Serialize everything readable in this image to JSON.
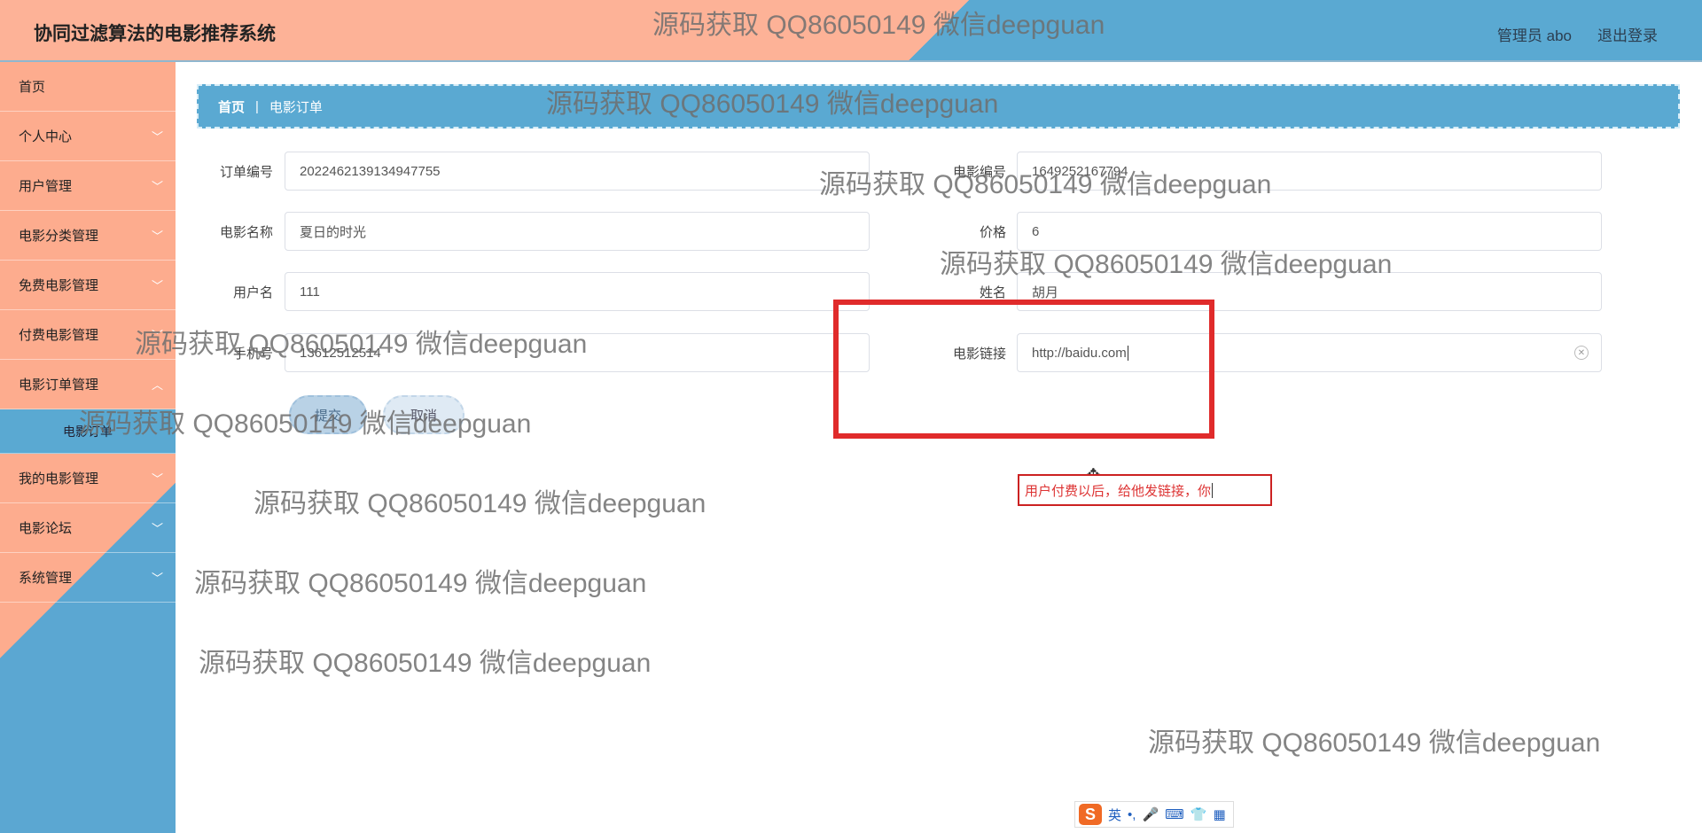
{
  "header": {
    "title": "协同过滤算法的电影推荐系统",
    "admin": "管理员 abo",
    "logout": "退出登录"
  },
  "sidebar": {
    "items": [
      {
        "label": "首页"
      },
      {
        "label": "个人中心"
      },
      {
        "label": "用户管理"
      },
      {
        "label": "电影分类管理"
      },
      {
        "label": "免费电影管理"
      },
      {
        "label": "付费电影管理"
      },
      {
        "label": "电影订单管理"
      },
      {
        "label": "我的电影管理"
      },
      {
        "label": "电影论坛"
      },
      {
        "label": "系统管理"
      }
    ],
    "submenu": "电影订单"
  },
  "breadcrumb": {
    "home": "首页",
    "separator": "|",
    "current": "电影订单"
  },
  "form": {
    "order_no_label": "订单编号",
    "order_no_value": "2022462139134947755",
    "movie_no_label": "电影编号",
    "movie_no_value": "1649252167794",
    "movie_name_label": "电影名称",
    "movie_name_value": "夏日的时光",
    "price_label": "价格",
    "price_value": "6",
    "username_label": "用户名",
    "username_value": "111",
    "name_label": "姓名",
    "name_value": "胡月",
    "phone_label": "手机号",
    "phone_value": "13612512514",
    "link_label": "电影链接",
    "link_value": "http://baidu.com",
    "submit_label": "提交",
    "cancel_label": "取消"
  },
  "annotation": "用户付费以后，给他发链接，你",
  "watermark": "源码获取 QQ86050149 微信deepguan",
  "ime": {
    "logo": "S",
    "lang": "英",
    "punct": "•,"
  },
  "colors": {
    "accent_blue": "#5aa9d2",
    "accent_salmon": "#fdb297",
    "highlight_red": "#e02b2b"
  }
}
